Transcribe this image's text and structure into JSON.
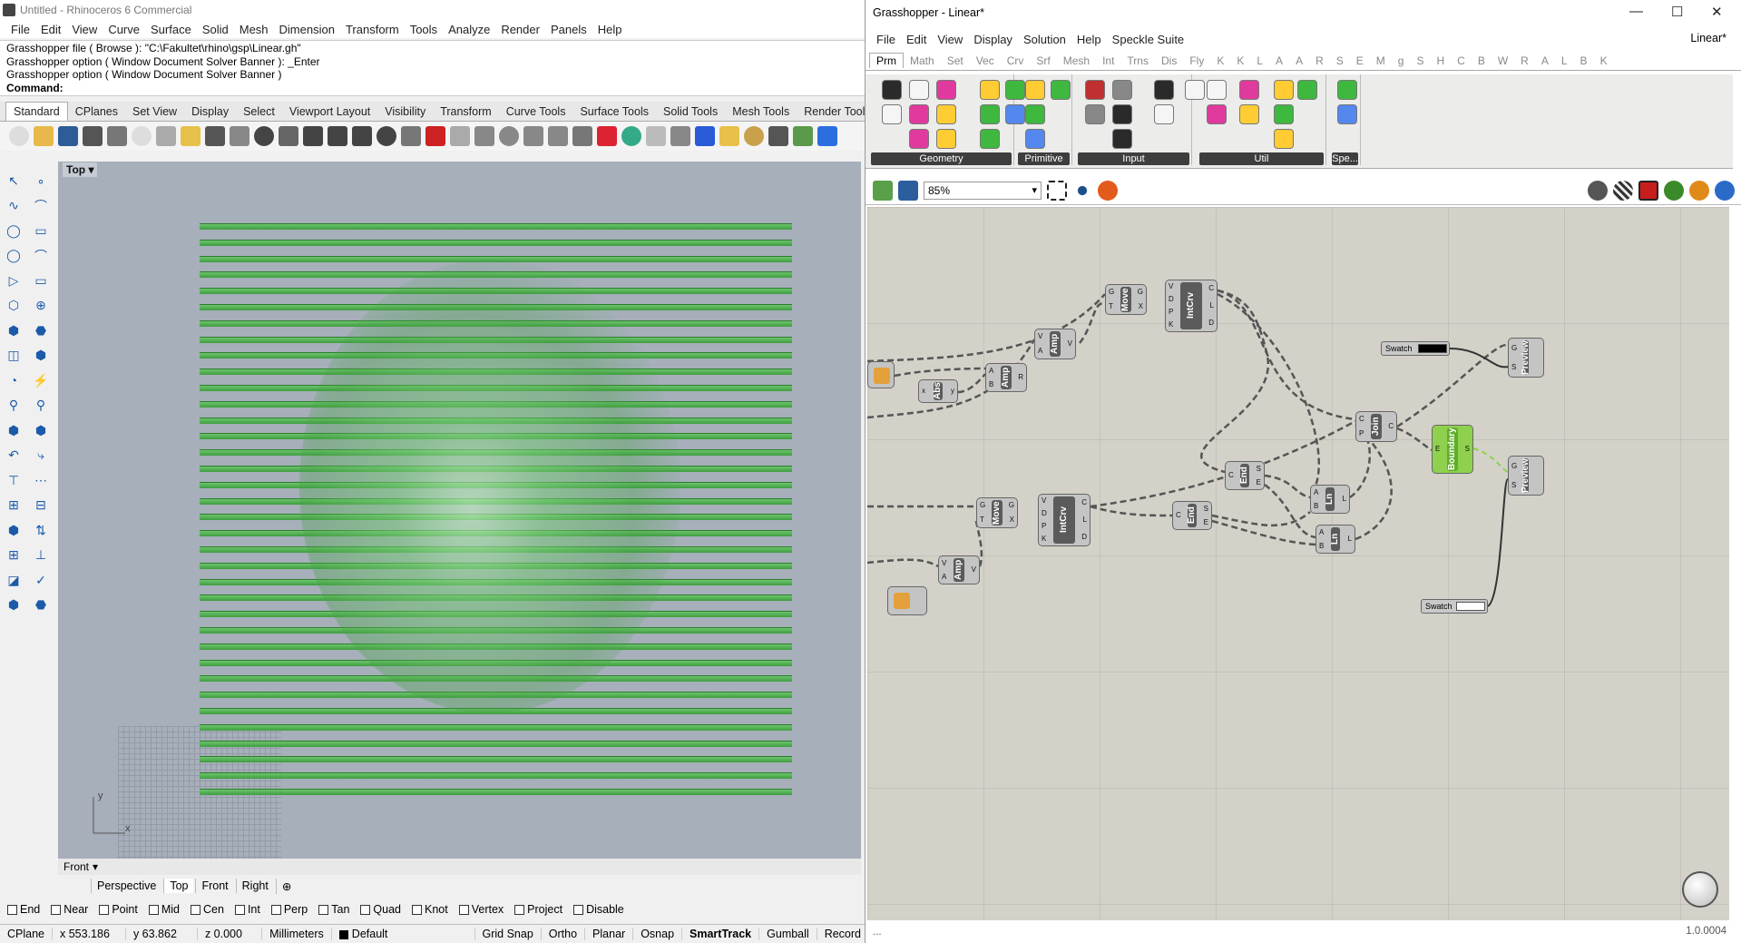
{
  "rhino": {
    "title": "Untitled - Rhinoceros 6 Commercial",
    "menu": [
      "File",
      "Edit",
      "View",
      "Curve",
      "Surface",
      "Solid",
      "Mesh",
      "Dimension",
      "Transform",
      "Tools",
      "Analyze",
      "Render",
      "Panels",
      "Help"
    ],
    "command_history": [
      "Grasshopper file ( Browse ): \"C:\\Fakultet\\rhino\\gsp\\Linear.gh\"",
      "Grasshopper option ( Window  Document  Solver  Banner ): _Enter",
      "Grasshopper option ( Window  Document  Solver  Banner )"
    ],
    "command_prompt": "Command:",
    "toolbar_tabs": [
      "Standard",
      "CPlanes",
      "Set View",
      "Display",
      "Select",
      "Viewport Layout",
      "Visibility",
      "Transform",
      "Curve Tools",
      "Surface Tools",
      "Solid Tools",
      "Mesh Tools",
      "Render Tools"
    ],
    "active_toolbar_tab": "Standard",
    "viewport": {
      "label": "Top",
      "axis_x": "x",
      "axis_y": "y",
      "bottom_label": "Front"
    },
    "view_tabs": [
      "Perspective",
      "Top",
      "Front",
      "Right"
    ],
    "active_view_tab": "Top",
    "osnaps": [
      "End",
      "Near",
      "Point",
      "Mid",
      "Cen",
      "Int",
      "Perp",
      "Tan",
      "Quad",
      "Knot",
      "Vertex",
      "Project",
      "Disable"
    ],
    "status": {
      "cplane": "CPlane",
      "x": "x 553.186",
      "y": "y 63.862",
      "z": "z 0.000",
      "units": "Millimeters",
      "layer": "Default",
      "modes": [
        "Grid Snap",
        "Ortho",
        "Planar",
        "Osnap",
        "SmartTrack",
        "Gumball",
        "Record"
      ]
    }
  },
  "gh": {
    "title": "Grasshopper - Linear*",
    "doc_tab": "Linear*",
    "menu": [
      "File",
      "Edit",
      "View",
      "Display",
      "Solution",
      "Help",
      "Speckle Suite"
    ],
    "category_tabs": [
      "Prm",
      "Math",
      "Set",
      "Vec",
      "Crv",
      "Srf",
      "Mesh",
      "Int",
      "Trns",
      "Dis",
      "Fly",
      "K",
      "K",
      "L",
      "A",
      "A",
      "R",
      "S",
      "E",
      "M",
      "g",
      "S",
      "H",
      "C",
      "B",
      "W",
      "R",
      "A",
      "L",
      "B",
      "K"
    ],
    "ribbon_groups": [
      "Geometry",
      "Primitive",
      "Input",
      "Util",
      "Spe..."
    ],
    "zoom": "85%",
    "components": {
      "move1": "Move",
      "intcrv1": "IntCrv",
      "amp1": "Amp",
      "abs": "Abs",
      "amp_top": "Amp",
      "move2": "Move",
      "intcrv2": "IntCrv",
      "amp2": "Amp",
      "join": "Join",
      "end1": "End",
      "end2": "End",
      "ln1": "Ln",
      "ln2": "Ln",
      "boundary": "Boundary",
      "preview1": "Preview",
      "preview2": "Preview",
      "swatch1": "Swatch",
      "swatch2": "Swatch"
    },
    "status_text": "...",
    "version": "1.0.0004"
  }
}
